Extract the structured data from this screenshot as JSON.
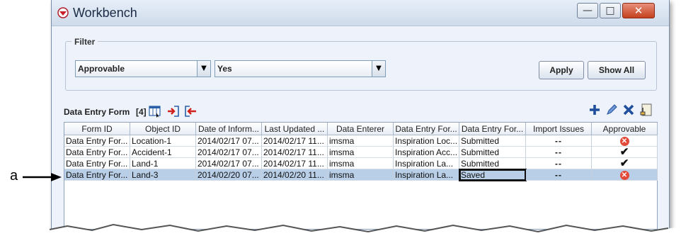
{
  "window": {
    "title": "Workbench"
  },
  "filter": {
    "label": "Filter",
    "field_value": "Approvable",
    "value_value": "Yes",
    "apply_label": "Apply",
    "show_all_label": "Show All"
  },
  "section": {
    "label": "Data Entry Form",
    "count": "[4]"
  },
  "table": {
    "columns": [
      "Form ID",
      "Object ID",
      "Date of Inform...",
      "Last Updated ...",
      "Data Enterer",
      "Data Entry For...",
      "Data Entry For...",
      "Import Issues",
      "Approvable"
    ],
    "rows": [
      {
        "form_id": "Data Entry For...",
        "object_id": "Location-1",
        "date_info": "2014/02/17 07...",
        "last_updated": "2014/02/17 11...",
        "enterer": "imsma",
        "template": "Inspiration Loc...",
        "status": "Submitted",
        "issues": "--",
        "approvable": "x-icon"
      },
      {
        "form_id": "Data Entry For...",
        "object_id": "Accident-1",
        "date_info": "2014/02/17 07...",
        "last_updated": "2014/02/17 11...",
        "enterer": "imsma",
        "template": "Inspiration Acc...",
        "status": "Submitted",
        "issues": "--",
        "approvable": "check-icon"
      },
      {
        "form_id": "Data Entry For...",
        "object_id": "Land-1",
        "date_info": "2014/02/17 07...",
        "last_updated": "2014/02/17 11...",
        "enterer": "imsma",
        "template": "Inspiration La...",
        "status": "Submitted",
        "issues": "--",
        "approvable": "check-icon"
      },
      {
        "form_id": "Data Entry For...",
        "object_id": "Land-3",
        "date_info": "2014/02/20 07...",
        "last_updated": "2014/02/20 11...",
        "enterer": "imsma",
        "template": "Inspiration La...",
        "status": "Saved",
        "issues": "--",
        "approvable": "x-icon"
      }
    ],
    "selected_row": 3
  },
  "callout": {
    "label": "a"
  },
  "colors": {
    "selection": "#b9cfe8",
    "close_button": "#c4411f",
    "error_icon": "#e24a3a"
  }
}
